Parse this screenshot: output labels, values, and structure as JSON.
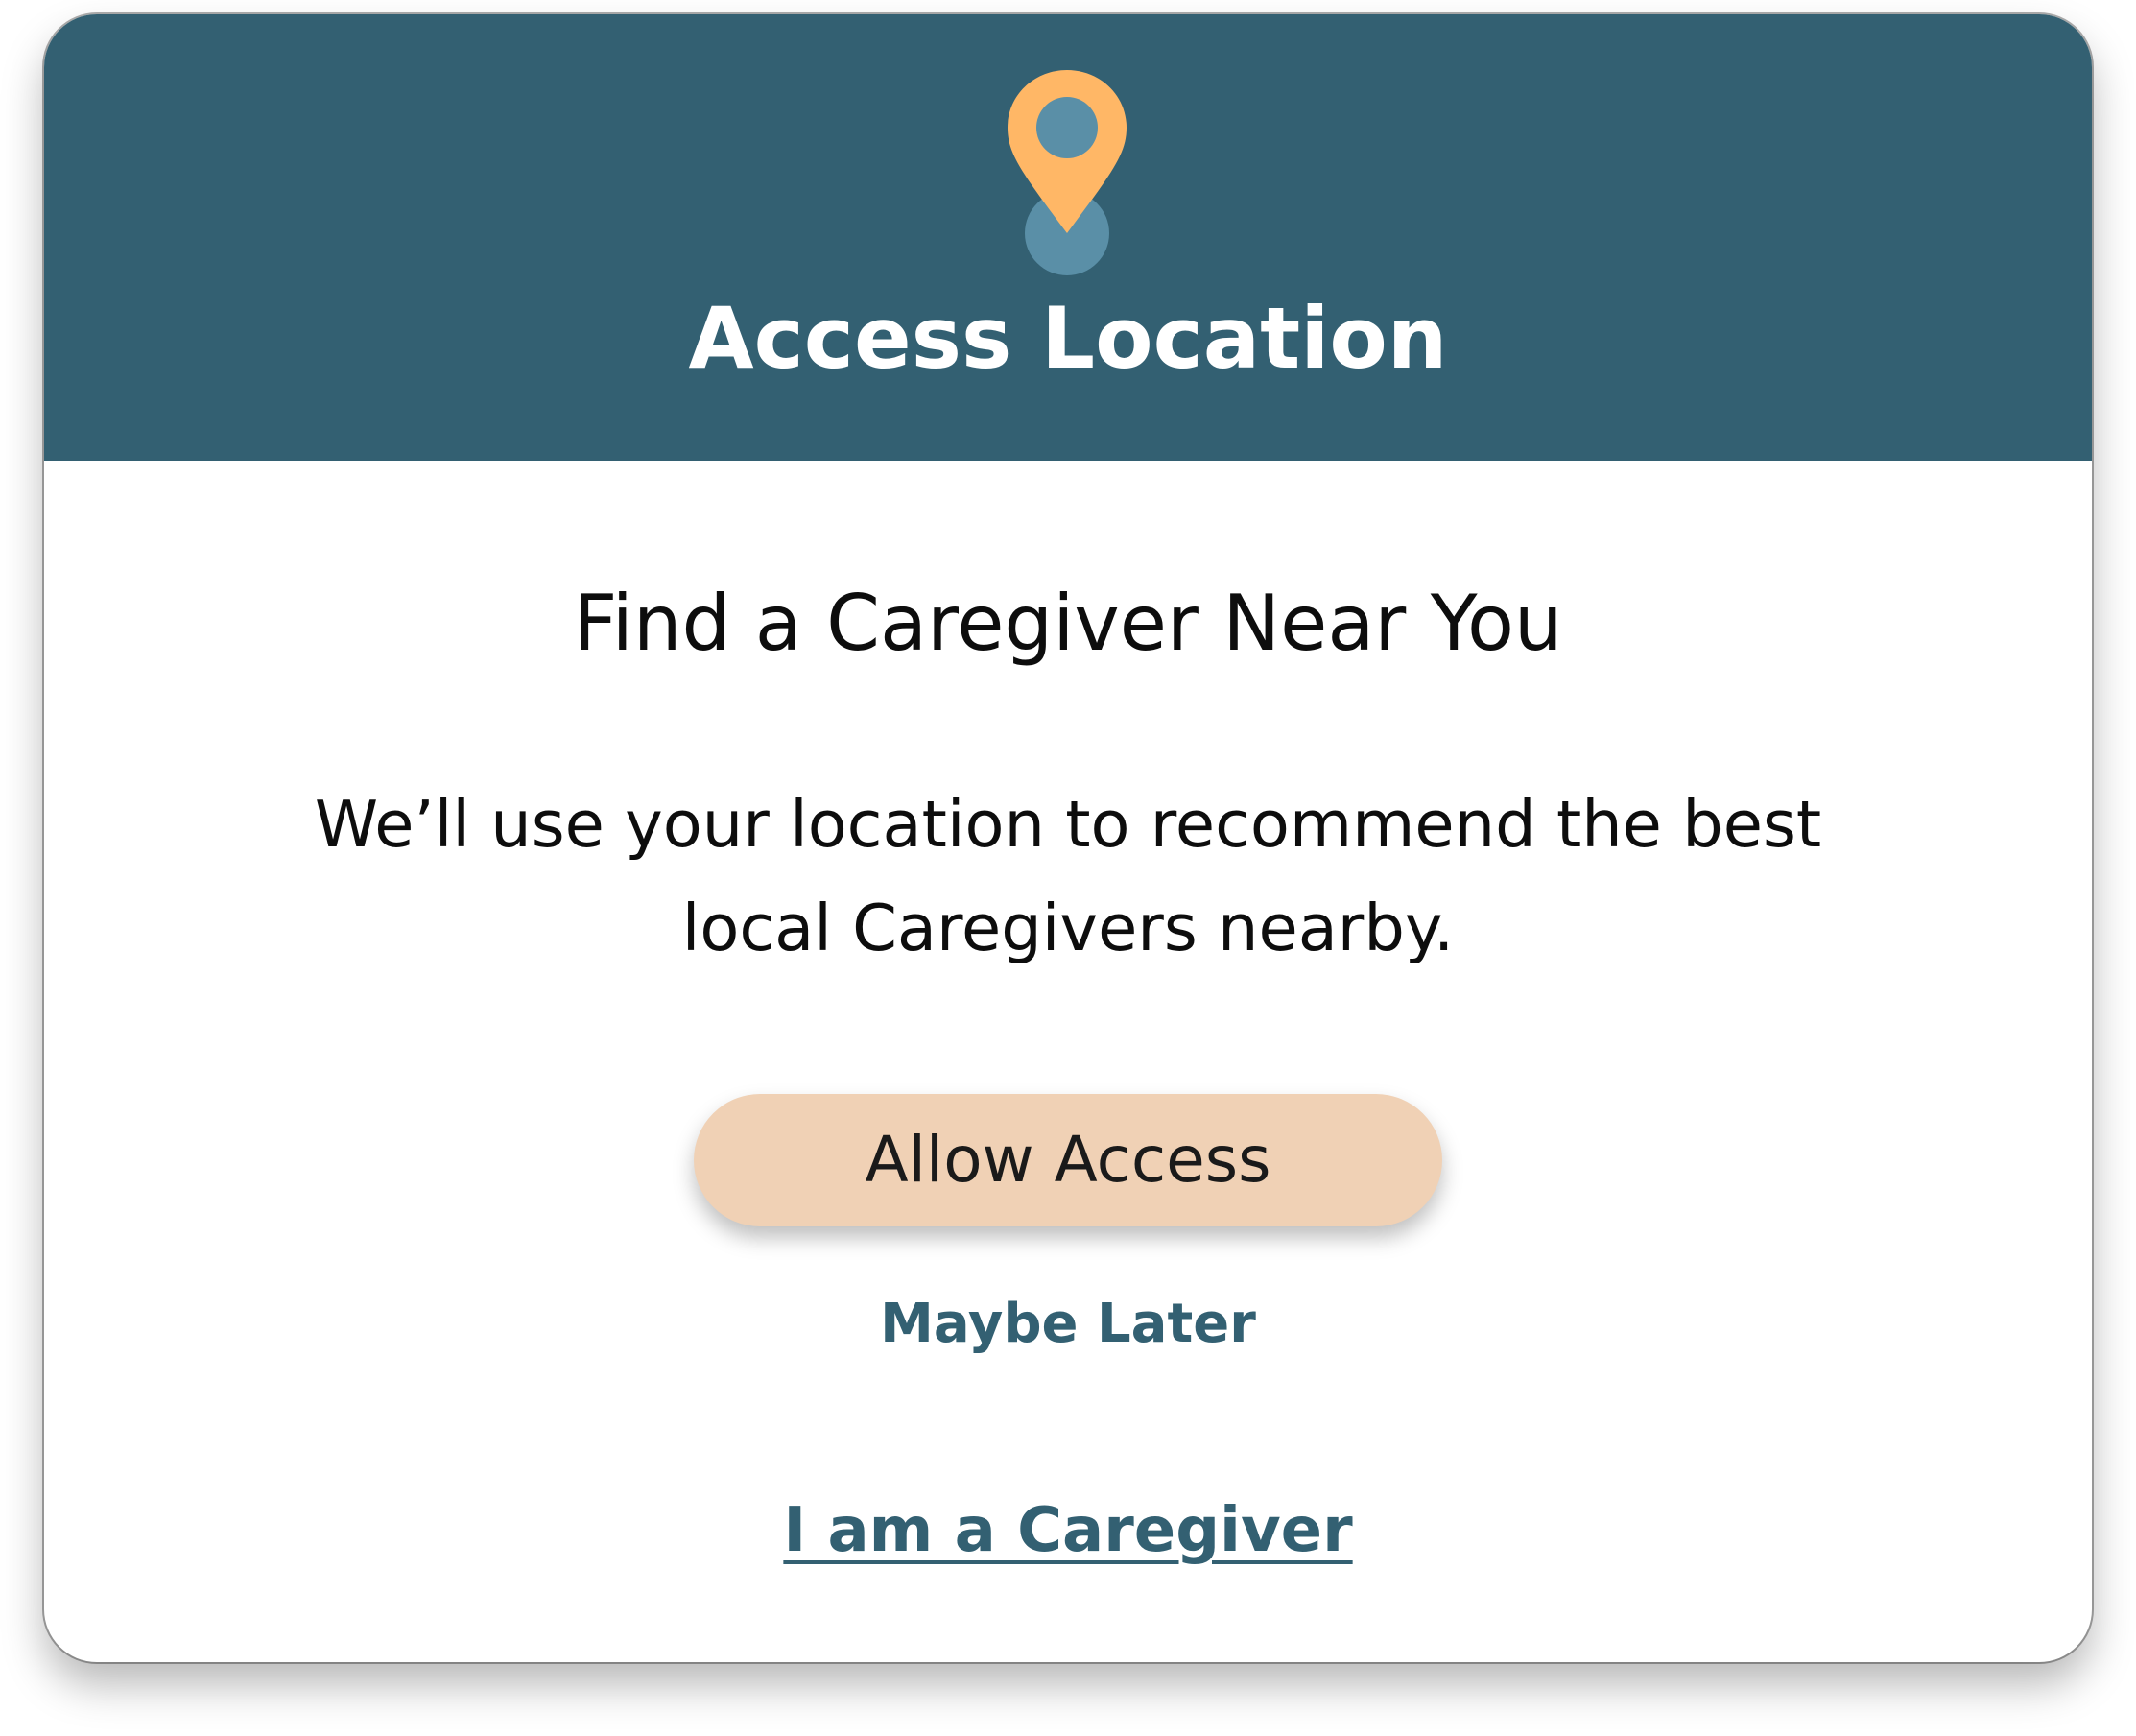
{
  "header": {
    "title": "Access Location",
    "icon": "location-pin-icon",
    "background_color": "#336072",
    "pin_color": "#FFB766",
    "pin_dot_color": "#5A8FA7"
  },
  "content": {
    "subtitle": "Find a Caregiver Near You",
    "description": "We’ll use your location to recommend the best local Caregivers nearby."
  },
  "actions": {
    "allow_label": "Allow Access",
    "allow_color": "#F0D1B5",
    "maybe_later_label": "Maybe Later",
    "caregiver_link_label": "I am a Caregiver",
    "link_color": "#336072"
  }
}
